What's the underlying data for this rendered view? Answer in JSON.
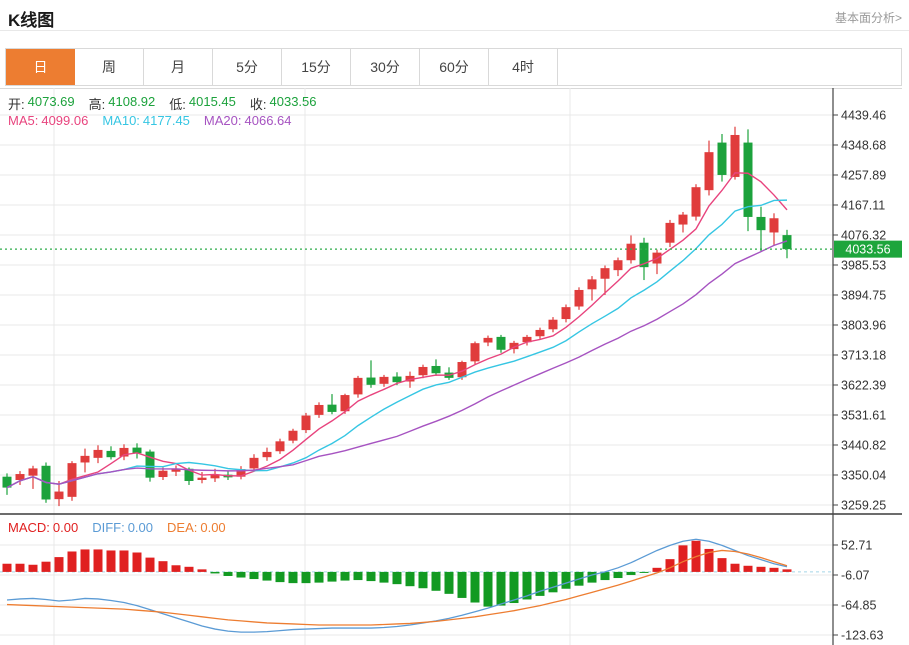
{
  "header": {
    "title": "K线图",
    "link": "基本面分析>"
  },
  "tabs": [
    {
      "id": "day",
      "label": "日",
      "active": true
    },
    {
      "id": "week",
      "label": "周",
      "active": false
    },
    {
      "id": "month",
      "label": "月",
      "active": false
    },
    {
      "id": "5min",
      "label": "5分",
      "active": false
    },
    {
      "id": "15min",
      "label": "15分",
      "active": false
    },
    {
      "id": "30min",
      "label": "30分",
      "active": false
    },
    {
      "id": "60min",
      "label": "60分",
      "active": false
    },
    {
      "id": "4hour",
      "label": "4时",
      "active": false
    }
  ],
  "legend": {
    "open_label": "开:",
    "open": "4073.69",
    "high_label": "高:",
    "high": "4108.92",
    "low_label": "低:",
    "low": "4015.45",
    "close_label": "收:",
    "close": "4033.56",
    "ma5_label": "MA5:",
    "ma5": "4099.06",
    "ma10_label": "MA10:",
    "ma10": "4177.45",
    "ma20_label": "MA20:",
    "ma20": "4066.64"
  },
  "macd_legend": {
    "macd_label": "MACD:",
    "macd": "0.00",
    "diff_label": "DIFF:",
    "diff": "0.00",
    "dea_label": "DEA:",
    "dea": "0.00"
  },
  "colors": {
    "up": "#e03c3c",
    "down": "#1ca23c",
    "ma5": "#e8447e",
    "ma10": "#36c6e3",
    "ma20": "#a653c1",
    "diff": "#5b9bd5",
    "dea": "#ed7d31",
    "hist_up": "#e02020",
    "hist_down": "#129a22",
    "price_line": "#2eac4a",
    "badge_bg": "#1da53c",
    "grid": "#e9e9e9",
    "axis": "#444444",
    "tick_text": "#333333",
    "accent": "#ed7d31",
    "macd_zero_dash": "#a5d5e6",
    "legend_value_green": "#1ca23c",
    "macd_red": "#e02020"
  },
  "chart_data": {
    "type": "candlestick+macd",
    "title": "K线图 日K",
    "legend_position": "top-left",
    "grid": true,
    "price_axis_ticks": [
      "4439.46",
      "4348.68",
      "4257.89",
      "4167.11",
      "4076.32",
      "3985.53",
      "3894.75",
      "3803.96",
      "3713.18",
      "3622.39",
      "3531.61",
      "3440.82",
      "3350.04",
      "3259.25"
    ],
    "macd_axis_ticks": [
      "52.71",
      "-6.07",
      "-64.85",
      "-123.63"
    ],
    "price_range": [
      3259.25,
      4439.46
    ],
    "macd_range": [
      -123.63,
      52.71
    ],
    "last_price": 4033.56,
    "last_price_label": "4033.56",
    "ma_values": {
      "ma5": 4099.06,
      "ma10": 4177.45,
      "ma20": 4066.64
    },
    "candles_ohlc": [
      [
        3345,
        3355,
        3290,
        3312
      ],
      [
        3335,
        3362,
        3320,
        3353
      ],
      [
        3348,
        3378,
        3308,
        3370
      ],
      [
        3378,
        3388,
        3266,
        3276
      ],
      [
        3277,
        3332,
        3256,
        3300
      ],
      [
        3284,
        3392,
        3272,
        3386
      ],
      [
        3388,
        3430,
        3358,
        3408
      ],
      [
        3402,
        3440,
        3386,
        3426
      ],
      [
        3423,
        3437,
        3397,
        3404
      ],
      [
        3406,
        3443,
        3395,
        3432
      ],
      [
        3433,
        3446,
        3400,
        3416
      ],
      [
        3421,
        3427,
        3330,
        3342
      ],
      [
        3344,
        3373,
        3335,
        3363
      ],
      [
        3360,
        3379,
        3347,
        3370
      ],
      [
        3369,
        3373,
        3320,
        3332
      ],
      [
        3335,
        3359,
        3325,
        3342
      ],
      [
        3340,
        3369,
        3329,
        3352
      ],
      [
        3351,
        3361,
        3335,
        3343
      ],
      [
        3345,
        3377,
        3337,
        3368
      ],
      [
        3370,
        3413,
        3361,
        3402
      ],
      [
        3404,
        3433,
        3393,
        3420
      ],
      [
        3422,
        3460,
        3414,
        3452
      ],
      [
        3454,
        3490,
        3446,
        3484
      ],
      [
        3486,
        3538,
        3477,
        3530
      ],
      [
        3532,
        3570,
        3523,
        3562
      ],
      [
        3563,
        3595,
        3534,
        3541
      ],
      [
        3543,
        3596,
        3535,
        3592
      ],
      [
        3594,
        3650,
        3584,
        3644
      ],
      [
        3645,
        3697,
        3614,
        3623
      ],
      [
        3626,
        3653,
        3617,
        3647
      ],
      [
        3648,
        3661,
        3622,
        3631
      ],
      [
        3633,
        3663,
        3614,
        3650
      ],
      [
        3652,
        3684,
        3643,
        3677
      ],
      [
        3680,
        3700,
        3650,
        3658
      ],
      [
        3660,
        3676,
        3638,
        3644
      ],
      [
        3646,
        3696,
        3638,
        3692
      ],
      [
        3694,
        3754,
        3686,
        3749
      ],
      [
        3751,
        3772,
        3740,
        3765
      ],
      [
        3768,
        3774,
        3720,
        3729
      ],
      [
        3731,
        3756,
        3718,
        3750
      ],
      [
        3752,
        3774,
        3742,
        3768
      ],
      [
        3770,
        3796,
        3762,
        3789
      ],
      [
        3791,
        3828,
        3782,
        3820
      ],
      [
        3822,
        3866,
        3812,
        3858
      ],
      [
        3860,
        3918,
        3850,
        3910
      ],
      [
        3912,
        3952,
        3878,
        3942
      ],
      [
        3944,
        3984,
        3895,
        3976
      ],
      [
        3970,
        4008,
        3952,
        4000
      ],
      [
        4000,
        4075,
        3990,
        4050
      ],
      [
        4053,
        4068,
        3940,
        3979
      ],
      [
        3990,
        4032,
        3958,
        4023
      ],
      [
        4053,
        4122,
        4040,
        4113
      ],
      [
        4108,
        4146,
        4084,
        4138
      ],
      [
        4132,
        4230,
        4120,
        4221
      ],
      [
        4212,
        4362,
        4196,
        4327
      ],
      [
        4356,
        4382,
        4238,
        4258
      ],
      [
        4252,
        4404,
        4244,
        4379
      ],
      [
        4356,
        4396,
        4088,
        4131
      ],
      [
        4131,
        4162,
        4028,
        4091
      ],
      [
        4084,
        4142,
        4044,
        4127
      ],
      [
        4076,
        4092,
        4006,
        4033.56
      ]
    ],
    "macd_hist": [
      16,
      16,
      14,
      20,
      29,
      40,
      44,
      44,
      42,
      42,
      38,
      28,
      21,
      13,
      10,
      5,
      -3,
      -8,
      -11,
      -14,
      -17,
      -20,
      -22,
      -22,
      -21,
      -19,
      -17,
      -16,
      -18,
      -21,
      -24,
      -28,
      -32,
      -37,
      -43,
      -51,
      -60,
      -68,
      -66,
      -61,
      -54,
      -47,
      -40,
      -33,
      -27,
      -21,
      -16,
      -12,
      -6,
      -2,
      8,
      25,
      52,
      61,
      45,
      27,
      16,
      12,
      10,
      8,
      5
    ],
    "diff_line": [
      -55,
      -53,
      -52,
      -54,
      -57,
      -55,
      -52,
      -53,
      -56,
      -60,
      -66,
      -74,
      -82,
      -90,
      -98,
      -106,
      -112,
      -116,
      -118,
      -118,
      -117,
      -115,
      -113,
      -112,
      -111,
      -110,
      -110,
      -110,
      -110,
      -109,
      -107,
      -104,
      -100,
      -96,
      -91,
      -85,
      -78,
      -71,
      -63,
      -55,
      -47,
      -38,
      -30,
      -22,
      -14,
      -6,
      0,
      8,
      18,
      30,
      42,
      52,
      60,
      64,
      60,
      52,
      42,
      32,
      24,
      16,
      10
    ],
    "dea_line": [
      -64,
      -65,
      -66,
      -67,
      -68,
      -69,
      -70,
      -71,
      -72,
      -73,
      -75,
      -77,
      -79,
      -82,
      -85,
      -88,
      -91,
      -94,
      -96,
      -98,
      -100,
      -101,
      -102,
      -103,
      -104,
      -104,
      -104,
      -104,
      -104,
      -103,
      -102,
      -101,
      -99,
      -97,
      -94,
      -91,
      -88,
      -84,
      -80,
      -76,
      -71,
      -66,
      -60,
      -54,
      -47,
      -40,
      -33,
      -26,
      -18,
      -10,
      -2,
      8,
      20,
      30,
      38,
      42,
      40,
      35,
      28,
      20,
      12
    ]
  }
}
